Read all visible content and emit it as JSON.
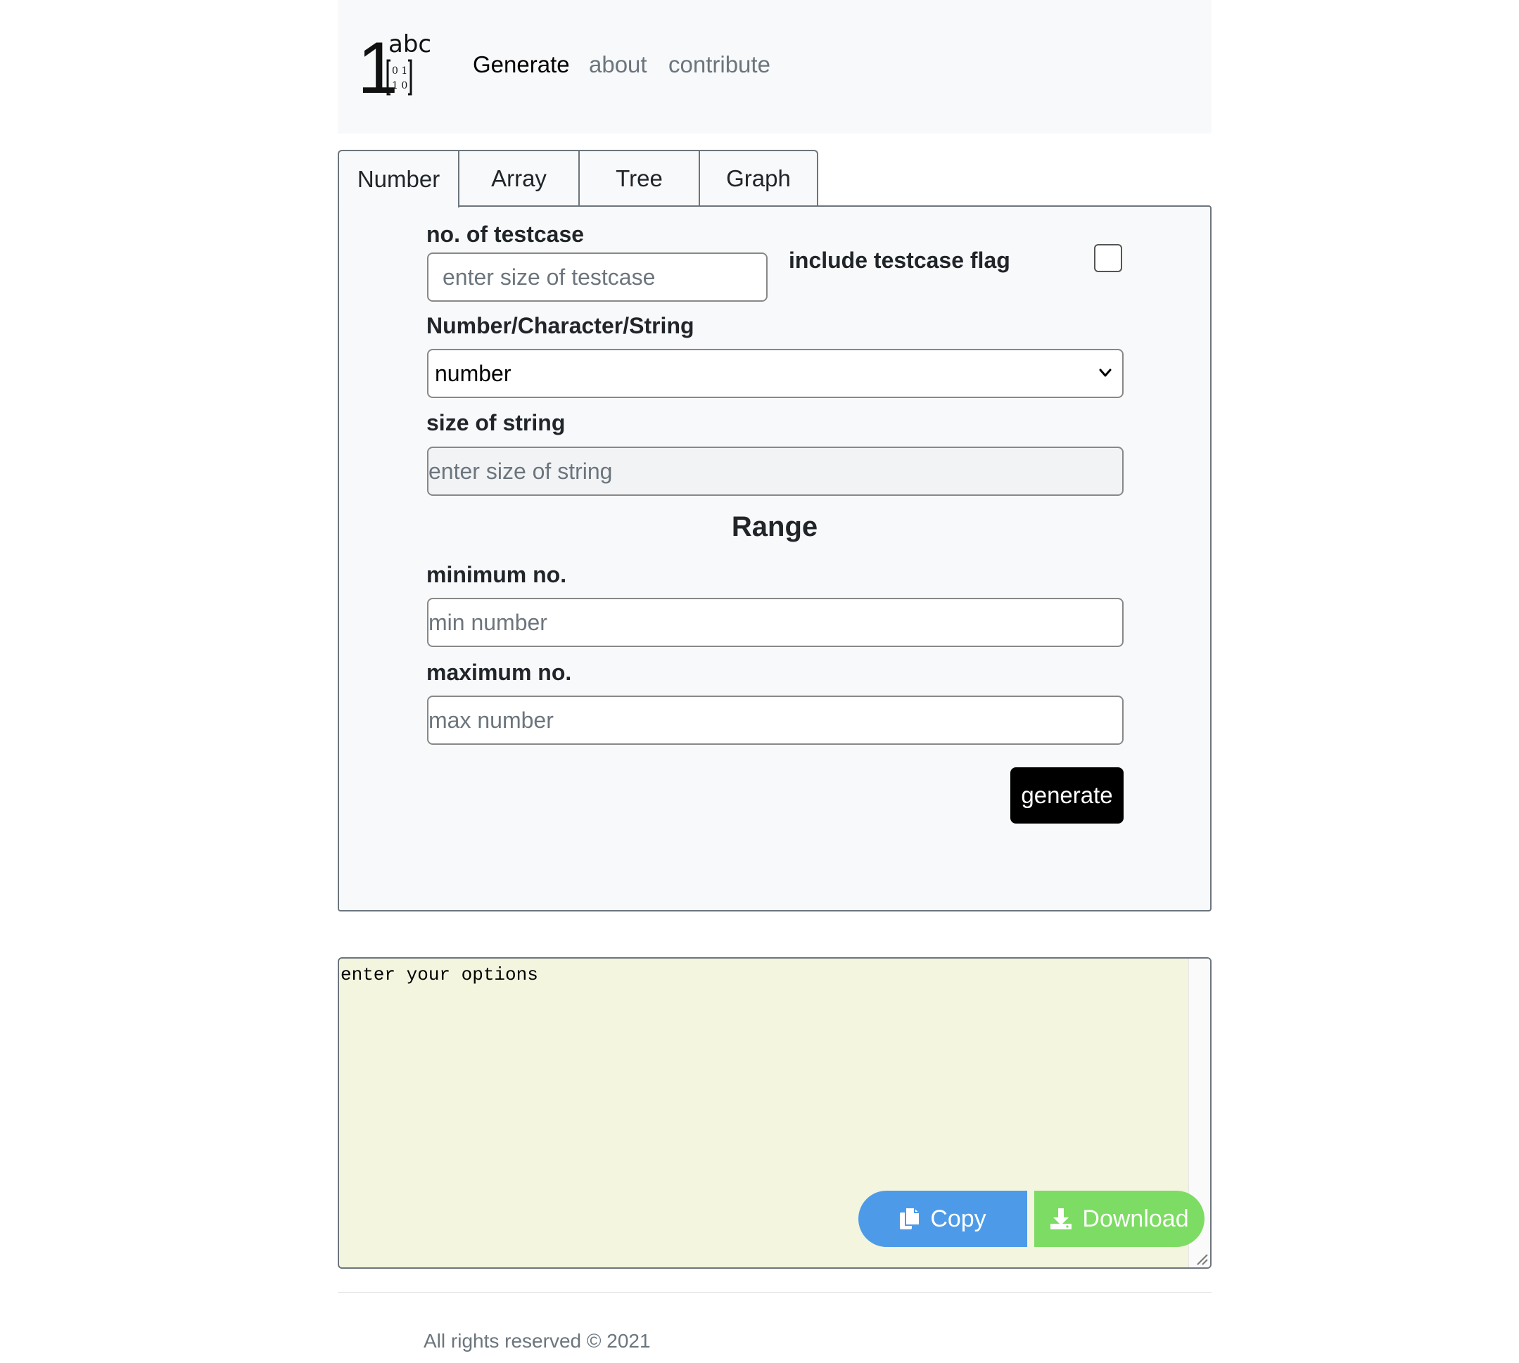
{
  "navbar": {
    "logo": {
      "number_glyph": "1",
      "letters": "abc",
      "matrix": [
        "0 1",
        "1 0"
      ]
    },
    "links": [
      {
        "label": "Generate",
        "active": true
      },
      {
        "label": "about",
        "active": false
      },
      {
        "label": "contribute",
        "active": false
      }
    ]
  },
  "tabs": [
    {
      "label": "Number",
      "active": true
    },
    {
      "label": "Array",
      "active": false
    },
    {
      "label": "Tree",
      "active": false
    },
    {
      "label": "Graph",
      "active": false
    }
  ],
  "form": {
    "testcase_label": "no. of testcase",
    "testcase_placeholder": "enter size of testcase",
    "testcase_value": "",
    "flag_label": "include testcase flag",
    "flag_checked": false,
    "type_label": "Number/Character/String",
    "type_selected": "number",
    "string_size_label": "size of string",
    "string_size_placeholder": "enter size of string",
    "range_title": "Range",
    "min_label": "minimum no.",
    "min_placeholder": "min number",
    "max_label": "maximum no.",
    "max_placeholder": "max number",
    "generate_label": "generate"
  },
  "output": {
    "text": "enter your options",
    "copy_label": "Copy",
    "download_label": "Download",
    "copy_color": "#4d9be8",
    "download_color": "#7ddc63",
    "copy_icon": "copy-icon",
    "download_icon": "download-icon"
  },
  "footer": {
    "text": "All rights reserved © 2021"
  }
}
